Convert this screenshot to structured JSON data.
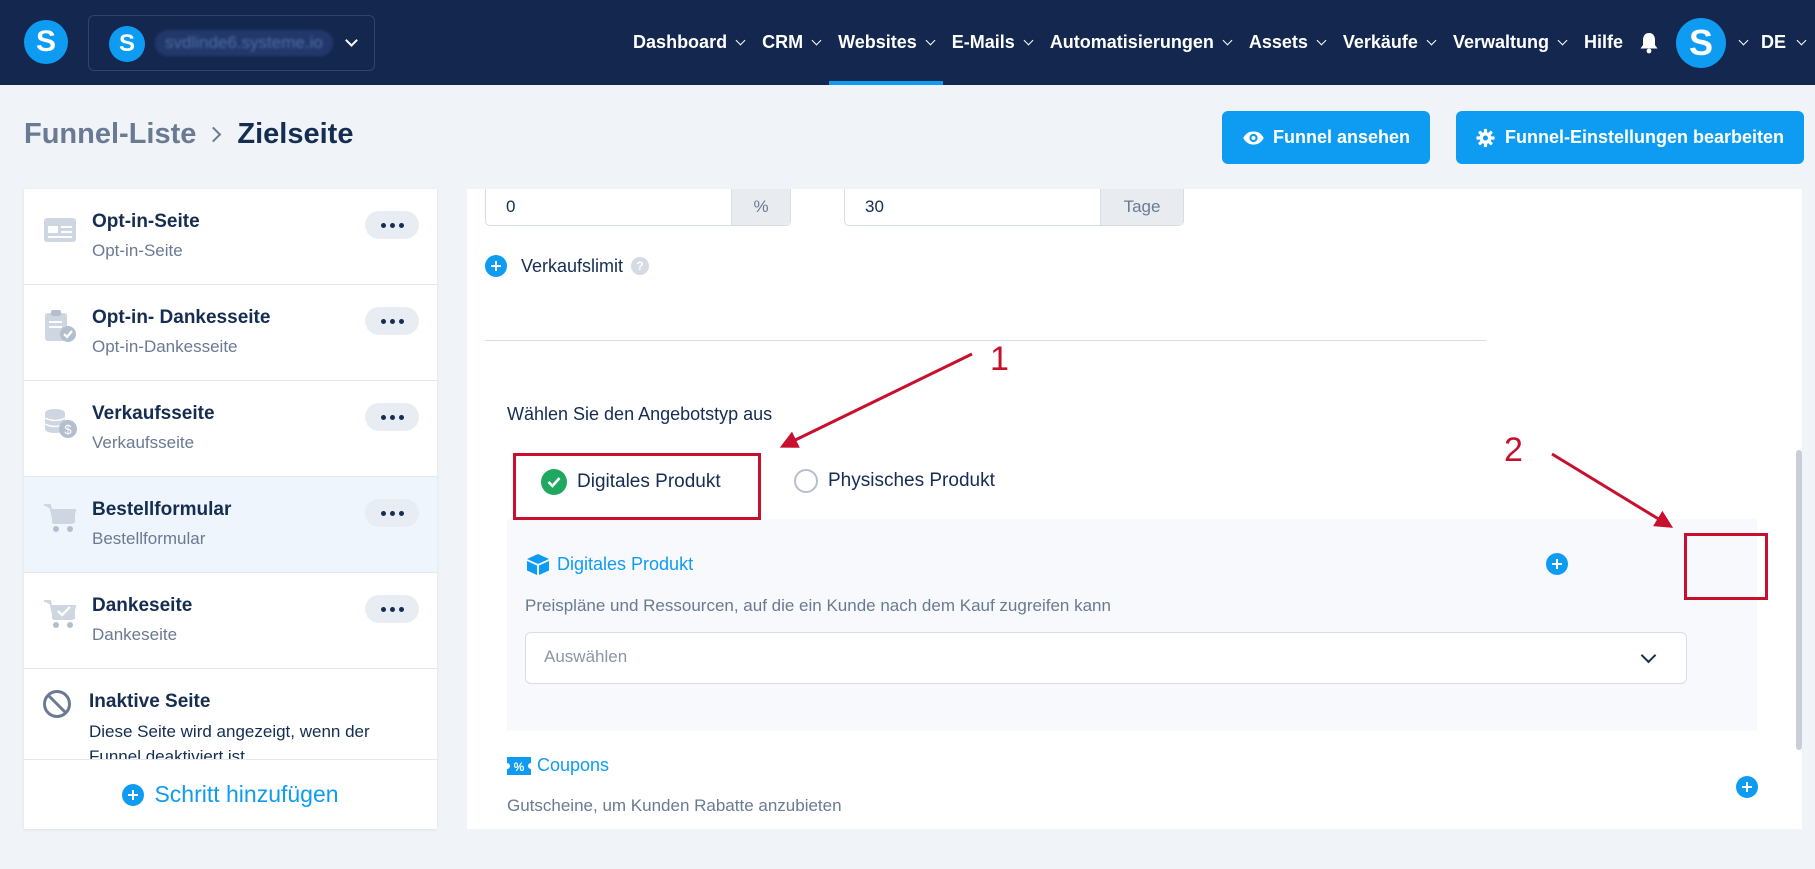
{
  "topnav": {
    "account_name": "svdlinde6.systeme.io",
    "items": [
      {
        "label": "Dashboard",
        "has_chevron": true
      },
      {
        "label": "CRM",
        "has_chevron": true
      },
      {
        "label": "Websites",
        "has_chevron": true,
        "active": true
      },
      {
        "label": "E-Mails",
        "has_chevron": true
      },
      {
        "label": "Automatisierungen",
        "has_chevron": true
      },
      {
        "label": "Assets",
        "has_chevron": true
      },
      {
        "label": "Verkäufe",
        "has_chevron": true
      },
      {
        "label": "Verwaltung",
        "has_chevron": true
      },
      {
        "label": "Hilfe",
        "has_chevron": false
      }
    ],
    "language": "DE",
    "logo_letter": "S"
  },
  "header": {
    "breadcrumb_root": "Funnel-Liste",
    "breadcrumb_current": "Zielseite",
    "view_funnel_label": "Funnel ansehen",
    "edit_settings_label": "Funnel-Einstellungen bearbeiten"
  },
  "sidebar": {
    "steps": [
      {
        "title": "Opt-in-Seite",
        "subtitle": "Opt-in-Seite",
        "icon": "optin-form-icon",
        "active": false
      },
      {
        "title": "Opt-in- Dankesseite",
        "subtitle": "Opt-in-Dankesseite",
        "icon": "clipboard-check-icon",
        "active": false
      },
      {
        "title": "Verkaufsseite",
        "subtitle": "Verkaufsseite",
        "icon": "coins-icon",
        "active": false
      },
      {
        "title": "Bestellformular",
        "subtitle": "Bestellformular",
        "icon": "cart-icon",
        "active": true
      },
      {
        "title": "Dankeseite",
        "subtitle": "Dankeseite",
        "icon": "cart-check-icon",
        "active": false
      }
    ],
    "inactive": {
      "title": "Inaktive Seite",
      "description": "Diese Seite wird angezeigt, wenn der Funnel deaktiviert ist"
    },
    "add_step_label": "Schritt hinzufügen"
  },
  "main": {
    "discount_value": "0",
    "discount_suffix": "%",
    "duration_value": "30",
    "duration_suffix": "Tage",
    "sales_limit_label": "Verkaufslimit",
    "help_symbol": "?",
    "offer_type_label": "Wählen Sie den Angebotstyp aus",
    "options": [
      {
        "label": "Digitales Produkt",
        "checked": true
      },
      {
        "label": "Physisches Produkt",
        "checked": false
      }
    ],
    "digital_product": {
      "title": "Digitales Produkt",
      "description": "Preispläne und Ressourcen, auf die ein Kunde nach dem Kauf zugreifen kann",
      "select_placeholder": "Auswählen"
    },
    "coupons": {
      "title": "Coupons",
      "description": "Gutscheine, um Kunden Rabatte anzubieten"
    }
  },
  "annotations": {
    "label_1": "1",
    "label_2": "2",
    "color": "#c8102e"
  },
  "colors": {
    "nav_bg": "#14284f",
    "accent": "#0e9cf2",
    "success": "#1fa860",
    "page_bg": "#f0f3f8"
  }
}
